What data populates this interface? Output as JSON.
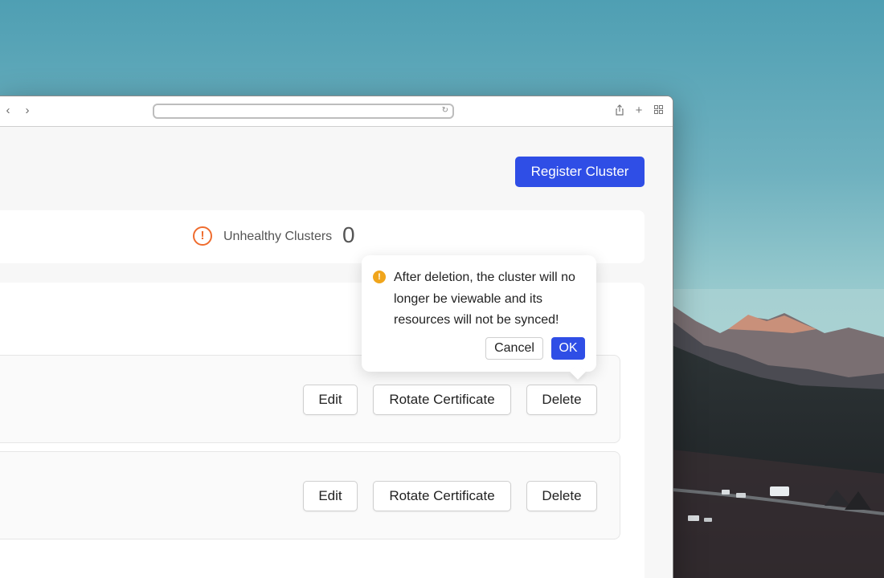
{
  "toolbar": {
    "back_icon": "chevron-left-icon",
    "forward_icon": "chevron-right-icon",
    "address_value": "",
    "reload_icon": "reload-icon",
    "share_icon": "share-icon",
    "new_tab_icon": "plus-icon",
    "tab_overview_icon": "tab-grid-icon"
  },
  "header": {
    "register_label": "Register Cluster"
  },
  "stats": {
    "icon": "warning-circle-icon",
    "unhealthy_label": "Unhealthy Clusters",
    "unhealthy_value": "0"
  },
  "clusters": [
    {
      "edit_label": "Edit",
      "rotate_label": "Rotate Certificate",
      "delete_label": "Delete"
    },
    {
      "edit_label": "Edit",
      "rotate_label": "Rotate Certificate",
      "delete_label": "Delete"
    }
  ],
  "popconfirm": {
    "icon": "exclamation-icon",
    "message": "After deletion, the cluster will no longer be viewable and its resources will not be synced!",
    "cancel_label": "Cancel",
    "ok_label": "OK"
  },
  "colors": {
    "primary": "#2f4ee6",
    "warning_orange": "#ef6c2e",
    "popconfirm_icon": "#f0a51c"
  }
}
